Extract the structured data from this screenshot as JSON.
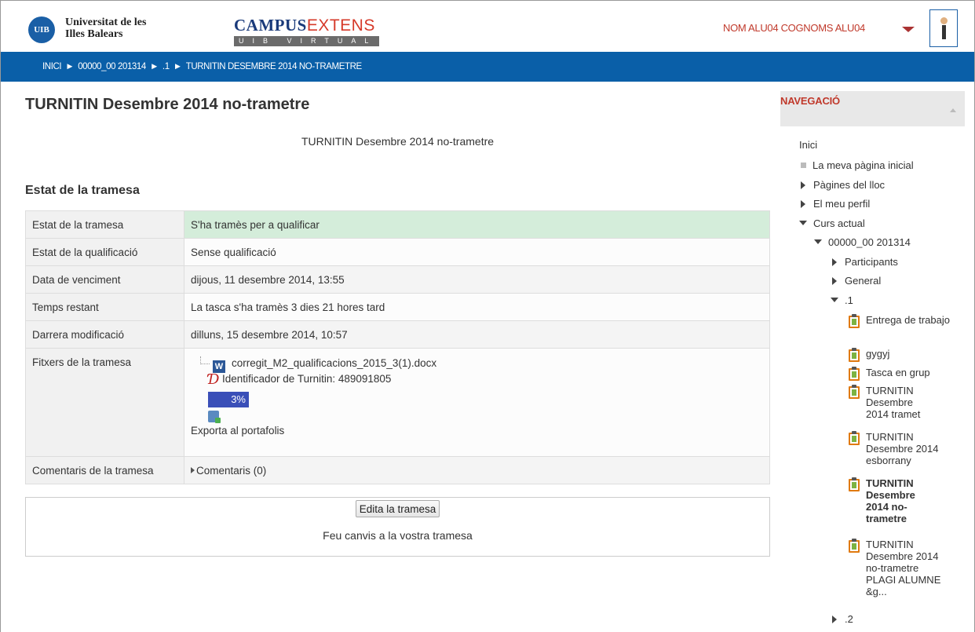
{
  "header": {
    "logo_text": "UIB",
    "university_line1": "Universitat de les",
    "university_line2": "Illes Balears",
    "campus_part1": "CAMPUS",
    "campus_part2": "EXTENS",
    "campus_sub": "UIB VIRTUAL",
    "user_name": "NOM ALU04 COGNOMS ALU04"
  },
  "breadcrumb": [
    "INICI",
    "00000_00 201314",
    ".1",
    "TURNITIN DESEMBRE 2014 NO-TRAMETRE"
  ],
  "breadcrumb_sep": "►",
  "main": {
    "title": "TURNITIN Desembre 2014 no-trametre",
    "intro": "TURNITIN Desembre 2014 no-trametre",
    "section_title": "Estat de la tramesa",
    "rows": [
      {
        "label": "Estat de la tramesa",
        "value": "S'ha tramès per a qualificar"
      },
      {
        "label": "Estat de la qualificació",
        "value": "Sense qualificació"
      },
      {
        "label": "Data de venciment",
        "value": "dijous, 11 desembre 2014, 13:55"
      },
      {
        "label": "Temps restant",
        "value": "La tasca s'ha tramès 3 dies 21 hores tard"
      },
      {
        "label": "Darrera modificació",
        "value": "dilluns, 15 desembre 2014, 10:57"
      }
    ],
    "files": {
      "label": "Fitxers de la tramesa",
      "file_name": "corregit_M2_qualificacions_2015_3(1).docx",
      "turnitin_id": "Identificador de Turnitin: 489091805",
      "similarity": "3%",
      "export": "Exporta al portafolis"
    },
    "comments": {
      "label": "Comentaris de la tramesa",
      "link": "Comentaris (0)"
    },
    "edit_button": "Edita la tramesa",
    "edit_note": "Feu canvis a la vostra tramesa"
  },
  "nav": {
    "title": "NAVEGACIÓ",
    "home": "Inici",
    "my_home": "La meva pàgina inicial",
    "site_pages": "Pàgines del lloc",
    "profile": "El meu perfil",
    "current_course": "Curs actual",
    "course": "00000_00 201314",
    "participants": "Participants",
    "general": "General",
    "section1": ".1",
    "activities": [
      "Entrega de trabajo",
      "gygyj",
      "Tasca en grup",
      "TURNITIN Desembre 2014 tramet",
      "TURNITIN Desembre 2014 esborrany",
      "TURNITIN Desembre 2014 no-trametre",
      "TURNITIN Desembre 2014 no-trametre PLAGI ALUMNE &g..."
    ],
    "section2": ".2"
  },
  "colors": {
    "brand_blue": "#0a5fa8",
    "accent_red": "#c0392b",
    "success_green": "#d4edda",
    "similarity_bar": "#3a4fb8"
  }
}
